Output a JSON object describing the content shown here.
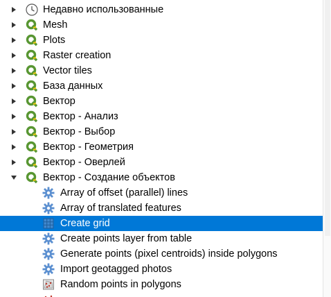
{
  "tree": {
    "groups": [
      {
        "label": "Недавно использованные",
        "icon": "clock-icon",
        "expanded": false
      },
      {
        "label": "Mesh",
        "icon": "qgis-logo-icon",
        "expanded": false
      },
      {
        "label": "Plots",
        "icon": "qgis-logo-icon",
        "expanded": false
      },
      {
        "label": "Raster creation",
        "icon": "qgis-logo-icon",
        "expanded": false
      },
      {
        "label": "Vector tiles",
        "icon": "qgis-logo-icon",
        "expanded": false
      },
      {
        "label": "База данных",
        "icon": "qgis-logo-icon",
        "expanded": false
      },
      {
        "label": "Вектор",
        "icon": "qgis-logo-icon",
        "expanded": false
      },
      {
        "label": "Вектор - Анализ",
        "icon": "qgis-logo-icon",
        "expanded": false
      },
      {
        "label": "Вектор - Выбор",
        "icon": "qgis-logo-icon",
        "expanded": false
      },
      {
        "label": "Вектор - Геометрия",
        "icon": "qgis-logo-icon",
        "expanded": false
      },
      {
        "label": "Вектор - Оверлей",
        "icon": "qgis-logo-icon",
        "expanded": false
      },
      {
        "label": "Вектор - Создание объектов",
        "icon": "qgis-logo-icon",
        "expanded": true
      }
    ],
    "children": [
      {
        "label": "Array of offset (parallel) lines",
        "icon": "gear-icon",
        "selected": false
      },
      {
        "label": "Array of translated features",
        "icon": "gear-icon",
        "selected": false
      },
      {
        "label": "Create grid",
        "icon": "grid-icon",
        "selected": true
      },
      {
        "label": "Create points layer from table",
        "icon": "gear-icon",
        "selected": false
      },
      {
        "label": "Generate points (pixel centroids) inside polygons",
        "icon": "gear-icon",
        "selected": false
      },
      {
        "label": "Import geotagged photos",
        "icon": "gear-icon",
        "selected": false
      },
      {
        "label": "Random points in polygons",
        "icon": "random-points-icon",
        "selected": false
      },
      {
        "label": "",
        "icon": "random-points-icon",
        "selected": false
      }
    ]
  },
  "colors": {
    "selection": "#0078d7",
    "qgis_green": "#589632",
    "qgis_yellow": "#eec90d",
    "gear_blue": "#5b8fd0"
  }
}
